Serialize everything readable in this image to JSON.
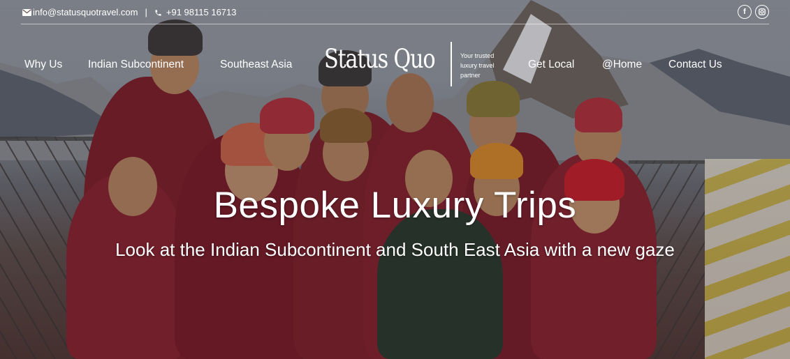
{
  "topbar": {
    "email": "info@statusquotravel.com",
    "separator": "|",
    "phone": "+91 98115 16713"
  },
  "nav": {
    "left": [
      "Why Us",
      "Indian Subcontinent",
      "Southeast Asia"
    ],
    "right": [
      "Get Local",
      "@Home",
      "Contact Us"
    ]
  },
  "logo": {
    "wordmark": "Status Quo",
    "tagline": "Your trusted luxury travel partner"
  },
  "hero": {
    "headline": "Bespoke Luxury Trips",
    "subheadline": "Look at the Indian Subcontinent and South East Asia with a new gaze"
  },
  "social": {
    "facebook_icon": "facebook-icon",
    "instagram_icon": "instagram-icon"
  }
}
